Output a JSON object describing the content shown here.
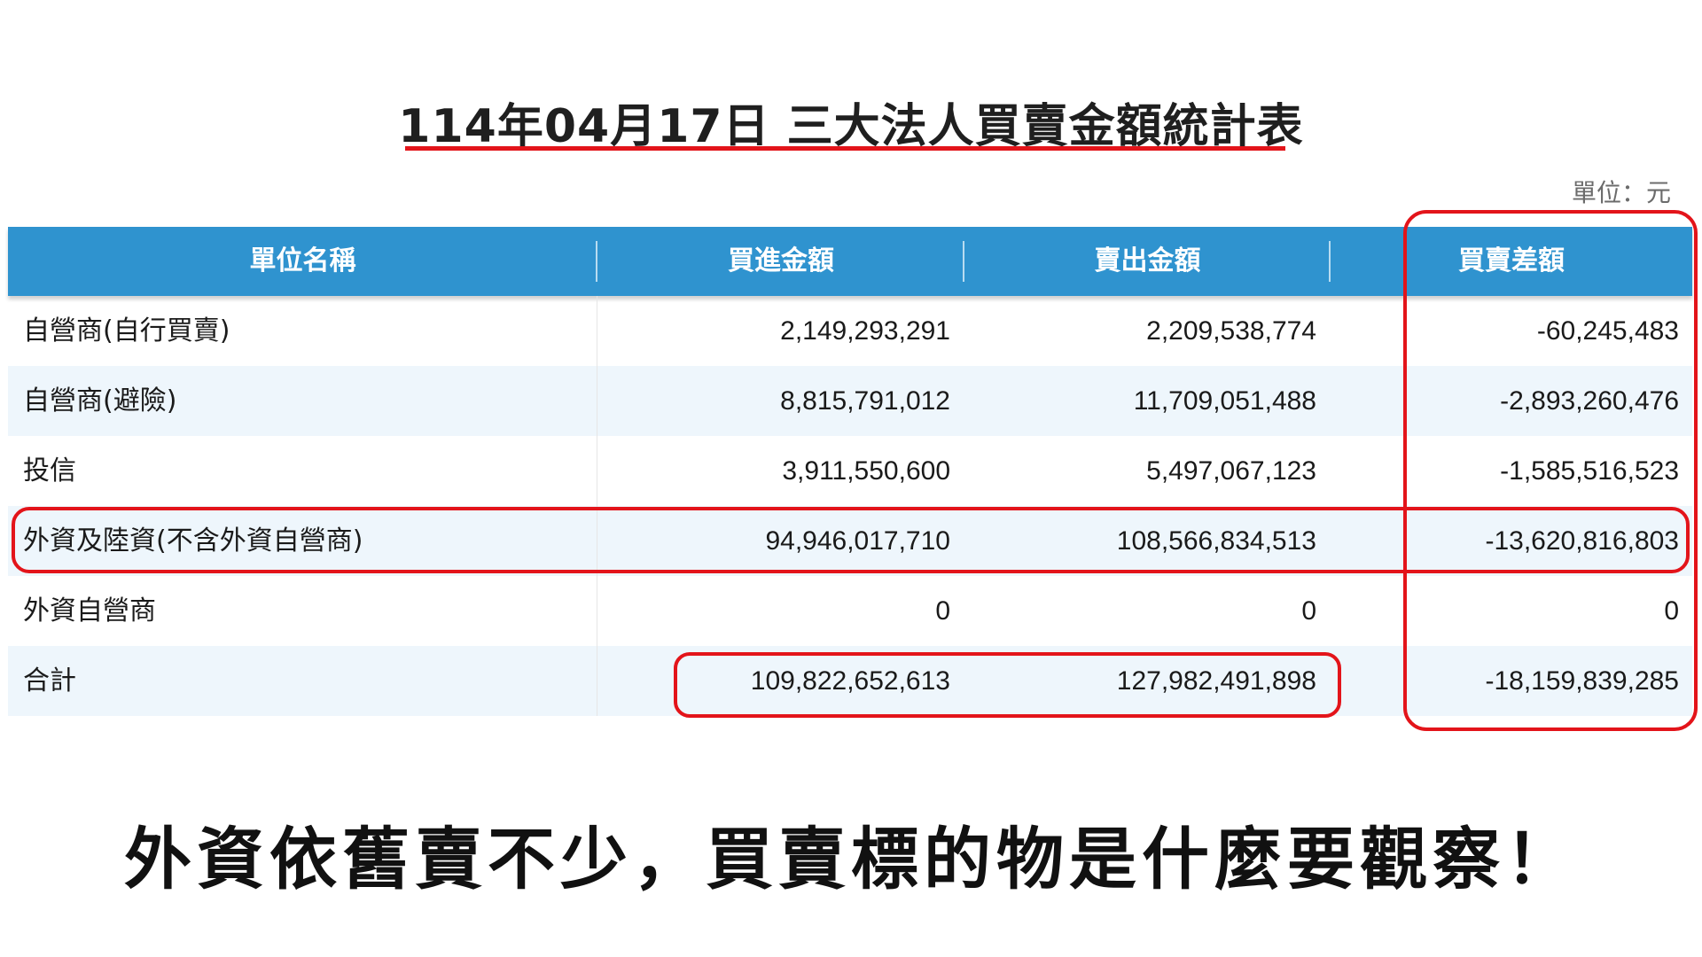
{
  "title": "114年04月17日 三大法人買賣金額統計表",
  "unit_label": "單位：元",
  "table": {
    "headers": [
      "單位名稱",
      "買進金額",
      "賣出金額",
      "買賣差額"
    ],
    "rows": [
      {
        "name": "自營商(自行買賣)",
        "buy": "2,149,293,291",
        "sell": "2,209,538,774",
        "diff": "-60,245,483"
      },
      {
        "name": "自營商(避險)",
        "buy": "8,815,791,012",
        "sell": "11,709,051,488",
        "diff": "-2,893,260,476"
      },
      {
        "name": "投信",
        "buy": "3,911,550,600",
        "sell": "5,497,067,123",
        "diff": "-1,585,516,523"
      },
      {
        "name": "外資及陸資(不含外資自營商)",
        "buy": "94,946,017,710",
        "sell": "108,566,834,513",
        "diff": "-13,620,816,803"
      },
      {
        "name": "外資自營商",
        "buy": "0",
        "sell": "0",
        "diff": "0"
      },
      {
        "name": "合計",
        "buy": "109,822,652,613",
        "sell": "127,982,491,898",
        "diff": "-18,159,839,285"
      }
    ]
  },
  "caption": "外資依舊賣不少，買賣標的物是什麼要觀察！",
  "colors": {
    "header_bg": "#2f93cf",
    "highlight": "#e3141a",
    "alt_row": "#eef6fc"
  }
}
